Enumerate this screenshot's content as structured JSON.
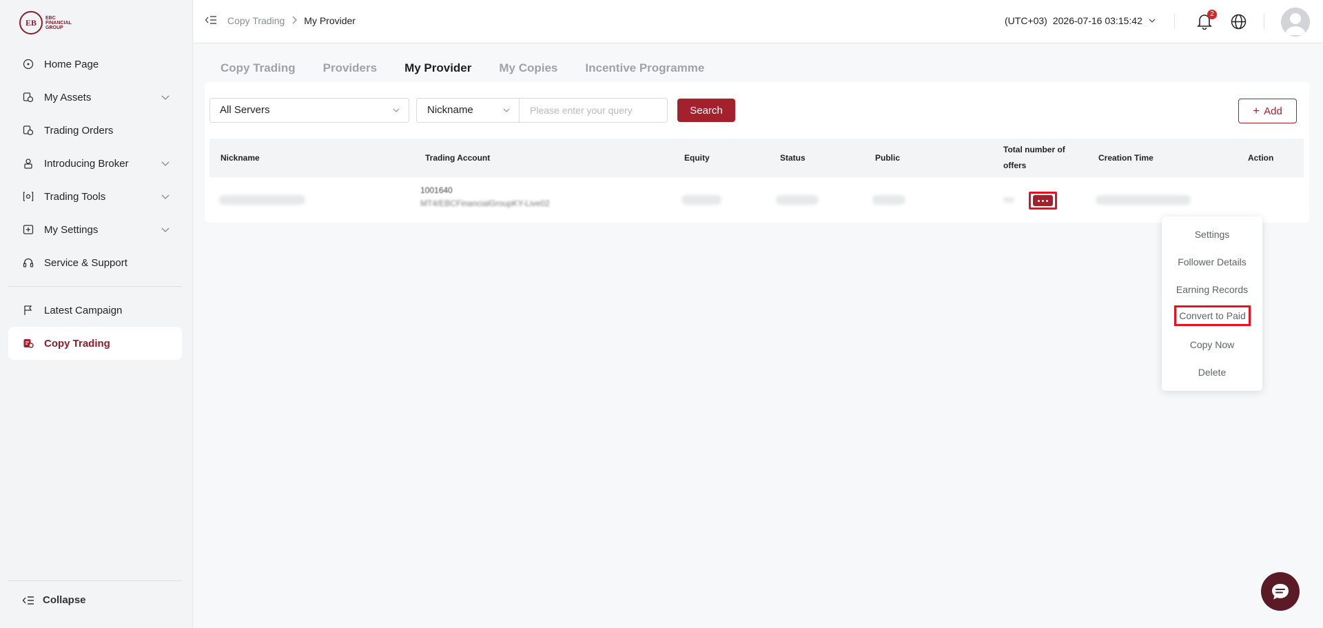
{
  "brand": {
    "logo_text": "EBC\nFINANCIAL\nGROUP",
    "accent_color": "#a3202d"
  },
  "sidebar": {
    "items": [
      {
        "label": "Home Page",
        "icon": "home-icon",
        "has_chevron": false
      },
      {
        "label": "My Assets",
        "icon": "assets-icon",
        "has_chevron": true
      },
      {
        "label": "Trading Orders",
        "icon": "orders-icon",
        "has_chevron": false
      },
      {
        "label": "Introducing Broker",
        "icon": "broker-icon",
        "has_chevron": true
      },
      {
        "label": "Trading Tools",
        "icon": "tools-icon",
        "has_chevron": true
      },
      {
        "label": "My Settings",
        "icon": "settings-icon",
        "has_chevron": true
      },
      {
        "label": "Service & Support",
        "icon": "headset-icon",
        "has_chevron": false
      },
      {
        "label": "Latest Campaign",
        "icon": "flag-icon",
        "has_chevron": false
      },
      {
        "label": "Copy Trading",
        "icon": "copy-trading-icon",
        "has_chevron": false,
        "active": true
      }
    ],
    "collapse_label": "Collapse"
  },
  "header": {
    "breadcrumb": [
      "Copy Trading",
      "My Provider"
    ],
    "timezone": "(UTC+03)",
    "datetime": "2026-07-16 03:15:42",
    "notification_count": "2"
  },
  "tabs": [
    {
      "label": "Copy Trading",
      "active": false
    },
    {
      "label": "Providers",
      "active": false
    },
    {
      "label": "My Provider",
      "active": true
    },
    {
      "label": "My Copies",
      "active": false
    },
    {
      "label": "Incentive Programme",
      "active": false
    }
  ],
  "filters": {
    "server_select": "All Servers",
    "field_select": "Nickname",
    "query_placeholder": "Please enter your query",
    "search_label": "Search",
    "add_label": "Add"
  },
  "table": {
    "headers": [
      "Nickname",
      "Trading Account",
      "Equity",
      "Status",
      "Public",
      "Total number of offers",
      "Creation Time",
      "Action"
    ],
    "row": {
      "account_top": "1001640",
      "account_bottom": "MT4/EBCFinancialGroupKY-Live02"
    }
  },
  "action_menu": {
    "items": [
      "Settings",
      "Follower Details",
      "Earning Records",
      "Convert to Paid",
      "Copy Now",
      "Delete"
    ],
    "highlighted": "Convert to Paid"
  }
}
